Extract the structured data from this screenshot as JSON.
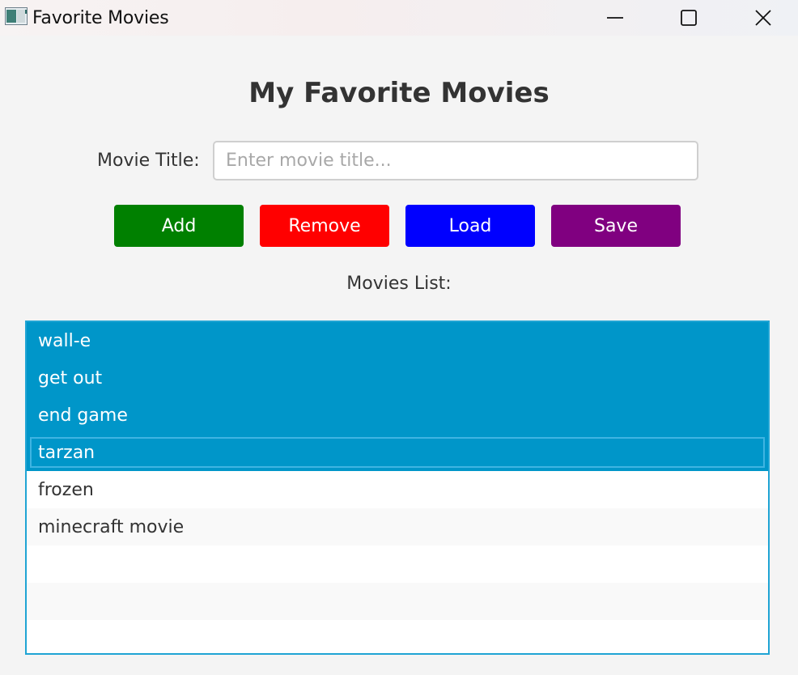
{
  "window": {
    "title": "Favorite Movies",
    "controls": [
      "minimize",
      "maximize",
      "close"
    ]
  },
  "main": {
    "heading": "My Favorite Movies",
    "movie_title_label": "Movie Title:",
    "movie_title_input": {
      "value": "",
      "placeholder": "Enter movie title..."
    },
    "buttons": {
      "add": "Add",
      "remove": "Remove",
      "load": "Load",
      "save": "Save"
    },
    "list_label": "Movies List:",
    "movies": [
      {
        "title": "wall-e",
        "selected": true
      },
      {
        "title": "get out",
        "selected": true
      },
      {
        "title": "end game",
        "selected": true
      },
      {
        "title": "tarzan",
        "selected": true,
        "focused": true
      },
      {
        "title": "frozen",
        "selected": false
      },
      {
        "title": "minecraft movie",
        "selected": false
      }
    ],
    "empty_rows": 3
  },
  "colors": {
    "add": "#008000",
    "remove": "#ff0000",
    "load": "#0000ff",
    "save": "#800080",
    "selection": "#0096c9",
    "list_border": "#1fa4d4"
  }
}
